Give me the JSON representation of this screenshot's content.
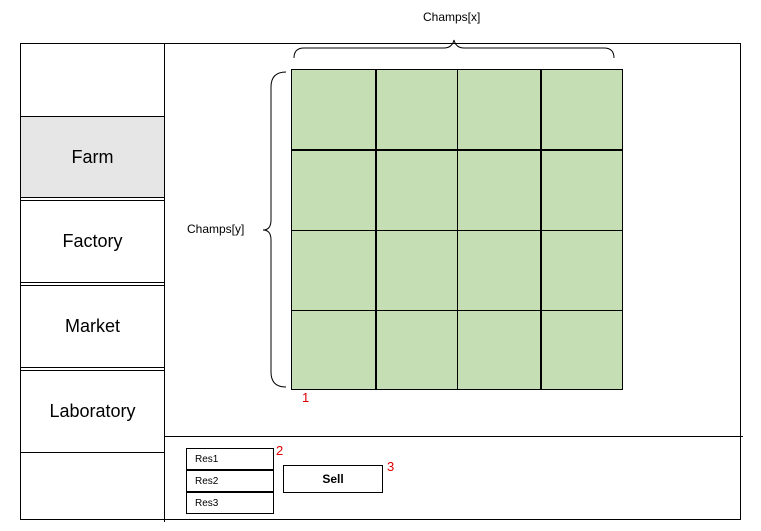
{
  "sidebar": {
    "items": [
      {
        "label": "Farm",
        "active": true
      },
      {
        "label": "Factory",
        "active": false
      },
      {
        "label": "Market",
        "active": false
      },
      {
        "label": "Laboratory",
        "active": false
      }
    ]
  },
  "grid": {
    "label_x": "Champs[x]",
    "label_y": "Champs[y]",
    "columns": 4,
    "rows": 4,
    "cell_color": "#c5deb4",
    "marker": "1"
  },
  "resources": {
    "items": [
      "Res1",
      "Res2",
      "Res3"
    ],
    "marker": "2"
  },
  "sell": {
    "label": "Sell",
    "marker": "3"
  },
  "colors": {
    "marker": "#e00000",
    "active_tab": "#e6e6e6"
  }
}
